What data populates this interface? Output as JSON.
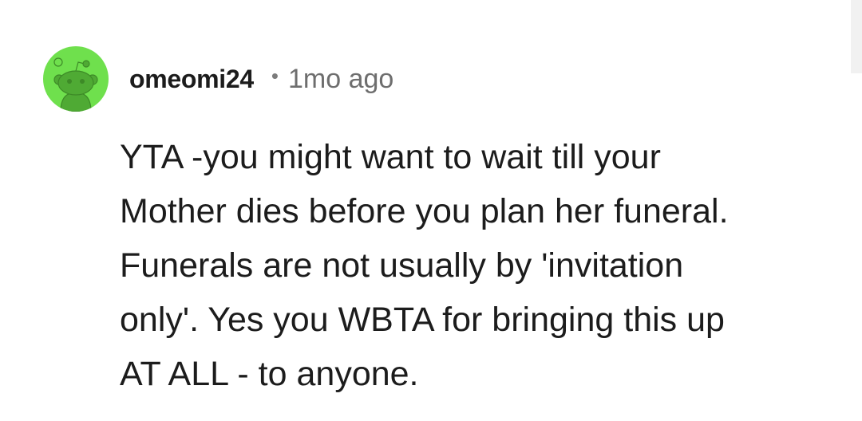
{
  "comment": {
    "author": "omeomi24",
    "separator": "•",
    "time_ago": "1mo ago",
    "avatar_icon": "reddit-snoo-icon",
    "avatar_bg_color": "#6fe04d",
    "body_lines": [
      "YTA -you might want to wait till your",
      "Mother dies before you plan her funeral.",
      "Funerals are not usually by 'invitation",
      "only'. Yes you WBTA for bringing this up",
      "AT ALL - to anyone."
    ]
  }
}
